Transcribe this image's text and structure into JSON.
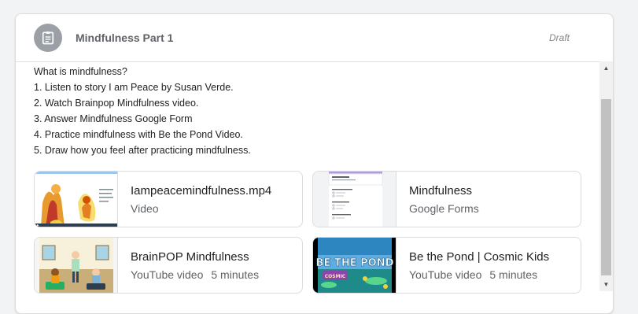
{
  "assignment": {
    "title": "Mindfulness Part 1",
    "status": "Draft",
    "icon": "assignment-icon"
  },
  "description": [
    "What is mindfulness?",
    "1. Listen to story I am Peace by Susan Verde.",
    "2. Watch Brainpop Mindfulness video.",
    "3. Answer Mindfulness Google Form",
    "4. Practice mindfulness with Be the Pond Video.",
    "5. Draw how you feel after practicing mindfulness."
  ],
  "attachments": [
    {
      "title": "Iampeacemindfulness.mp4",
      "type": "Video",
      "duration": ""
    },
    {
      "title": "Mindfulness",
      "type": "Google Forms",
      "duration": ""
    },
    {
      "title": "BrainPOP Mindfulness",
      "type": "YouTube video",
      "duration": "5 minutes"
    },
    {
      "title": "Be the Pond | Cosmic Kids",
      "type": "YouTube video",
      "duration": "5 minutes"
    }
  ],
  "thumbnails": {
    "pond_text": "BE THE POND",
    "pond_badge": "COSMIC"
  },
  "colors": {
    "icon_bg": "#9aa0a6",
    "title": "#5f6368",
    "text": "#202124",
    "border": "#dadce0"
  }
}
